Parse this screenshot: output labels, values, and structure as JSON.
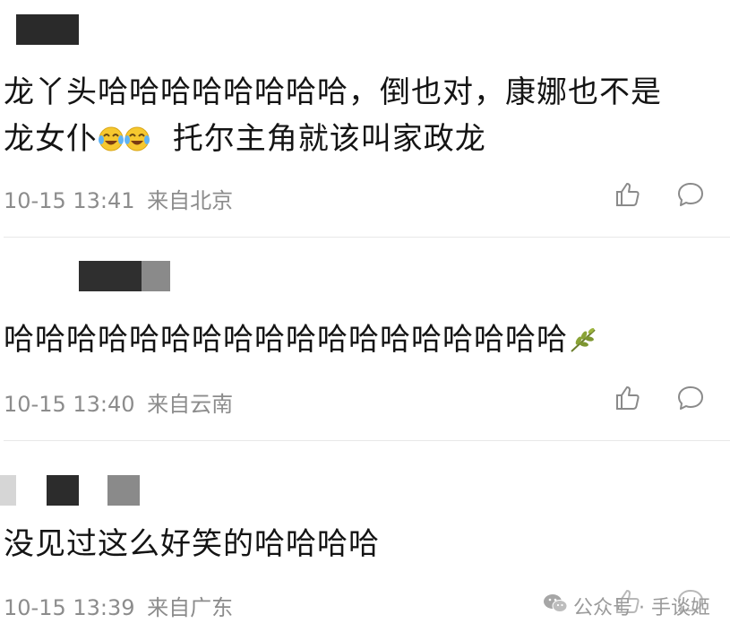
{
  "comments": [
    {
      "text_line1": "龙丫头哈哈哈哈哈哈哈哈，倒也对，康娜也不是",
      "text_line2_a": "龙女仆",
      "emoji": "cry-laugh-emoji",
      "text_line2_b": "托尔主角就该叫家政龙",
      "time": "10-15 13:41",
      "location": "来自北京"
    },
    {
      "text": "哈哈哈哈哈哈哈哈哈哈哈哈哈哈哈哈哈哈",
      "emoji": "leaf-emoji",
      "time": "10-15 13:40",
      "location": "来自云南"
    },
    {
      "text": "没见过这么好笑的哈哈哈哈",
      "time": "10-15 13:39",
      "location": "来自广东"
    }
  ],
  "watermark": {
    "icon": "wechat-icon",
    "text": "公众号 · 手谈姬"
  }
}
